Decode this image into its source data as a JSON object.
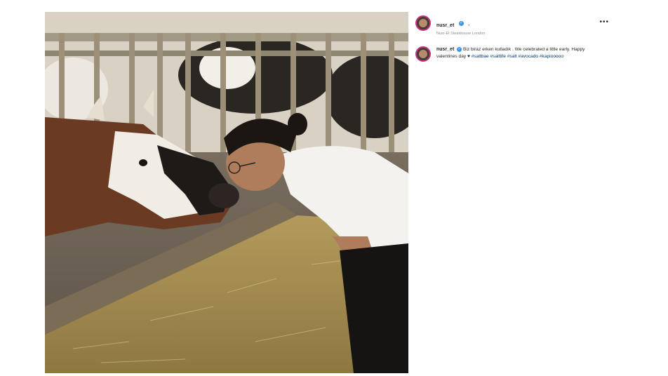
{
  "post": {
    "username": "nusr_et",
    "verified_mark": "✓",
    "separator": "•",
    "location": "Nusr-Et Steakhouse London",
    "more": "•••",
    "caption_text": "Biz biraz erken kutladık . We celebrated a little early. Happy valentines day ♥",
    "hashtags": "#saltbae #saltlife #salt #avocado #kapiooooo"
  },
  "colors": {
    "accent": "#3897f0",
    "hashtag": "#00376b",
    "avatar_ring": "#c13584"
  },
  "icons": {
    "more": "more-options-icon",
    "verified": "verified-badge-icon"
  }
}
